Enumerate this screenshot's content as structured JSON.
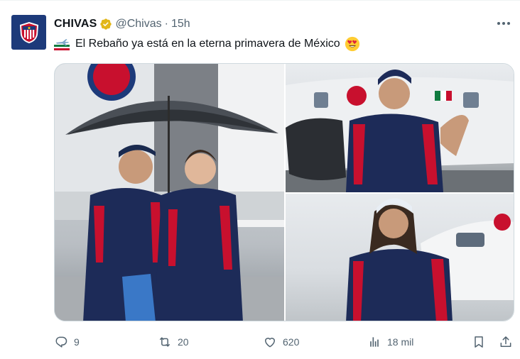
{
  "account": {
    "name": "CHIVAS",
    "handle": "@Chivas",
    "separator": "·",
    "time": "15h",
    "verified_color": "#e2b719"
  },
  "tweet": {
    "text": "El Rebaño ya está en la eterna primavera de México",
    "leading_emoji": "airplane-arrival-emoji",
    "trailing_emoji": "heart-eyes-emoji"
  },
  "media": {
    "photos": [
      {
        "name": "photo-players-under-umbrella"
      },
      {
        "name": "photo-player-with-bag"
      },
      {
        "name": "photo-player-long-hair"
      }
    ]
  },
  "actions": {
    "replies": "9",
    "reposts": "20",
    "likes": "620",
    "views": "18 mil"
  },
  "colors": {
    "text_primary": "#0f1419",
    "text_secondary": "#536471",
    "border": "#cfd9de",
    "brand_navy": "#1d3a7a",
    "brand_red": "#c8102e"
  }
}
